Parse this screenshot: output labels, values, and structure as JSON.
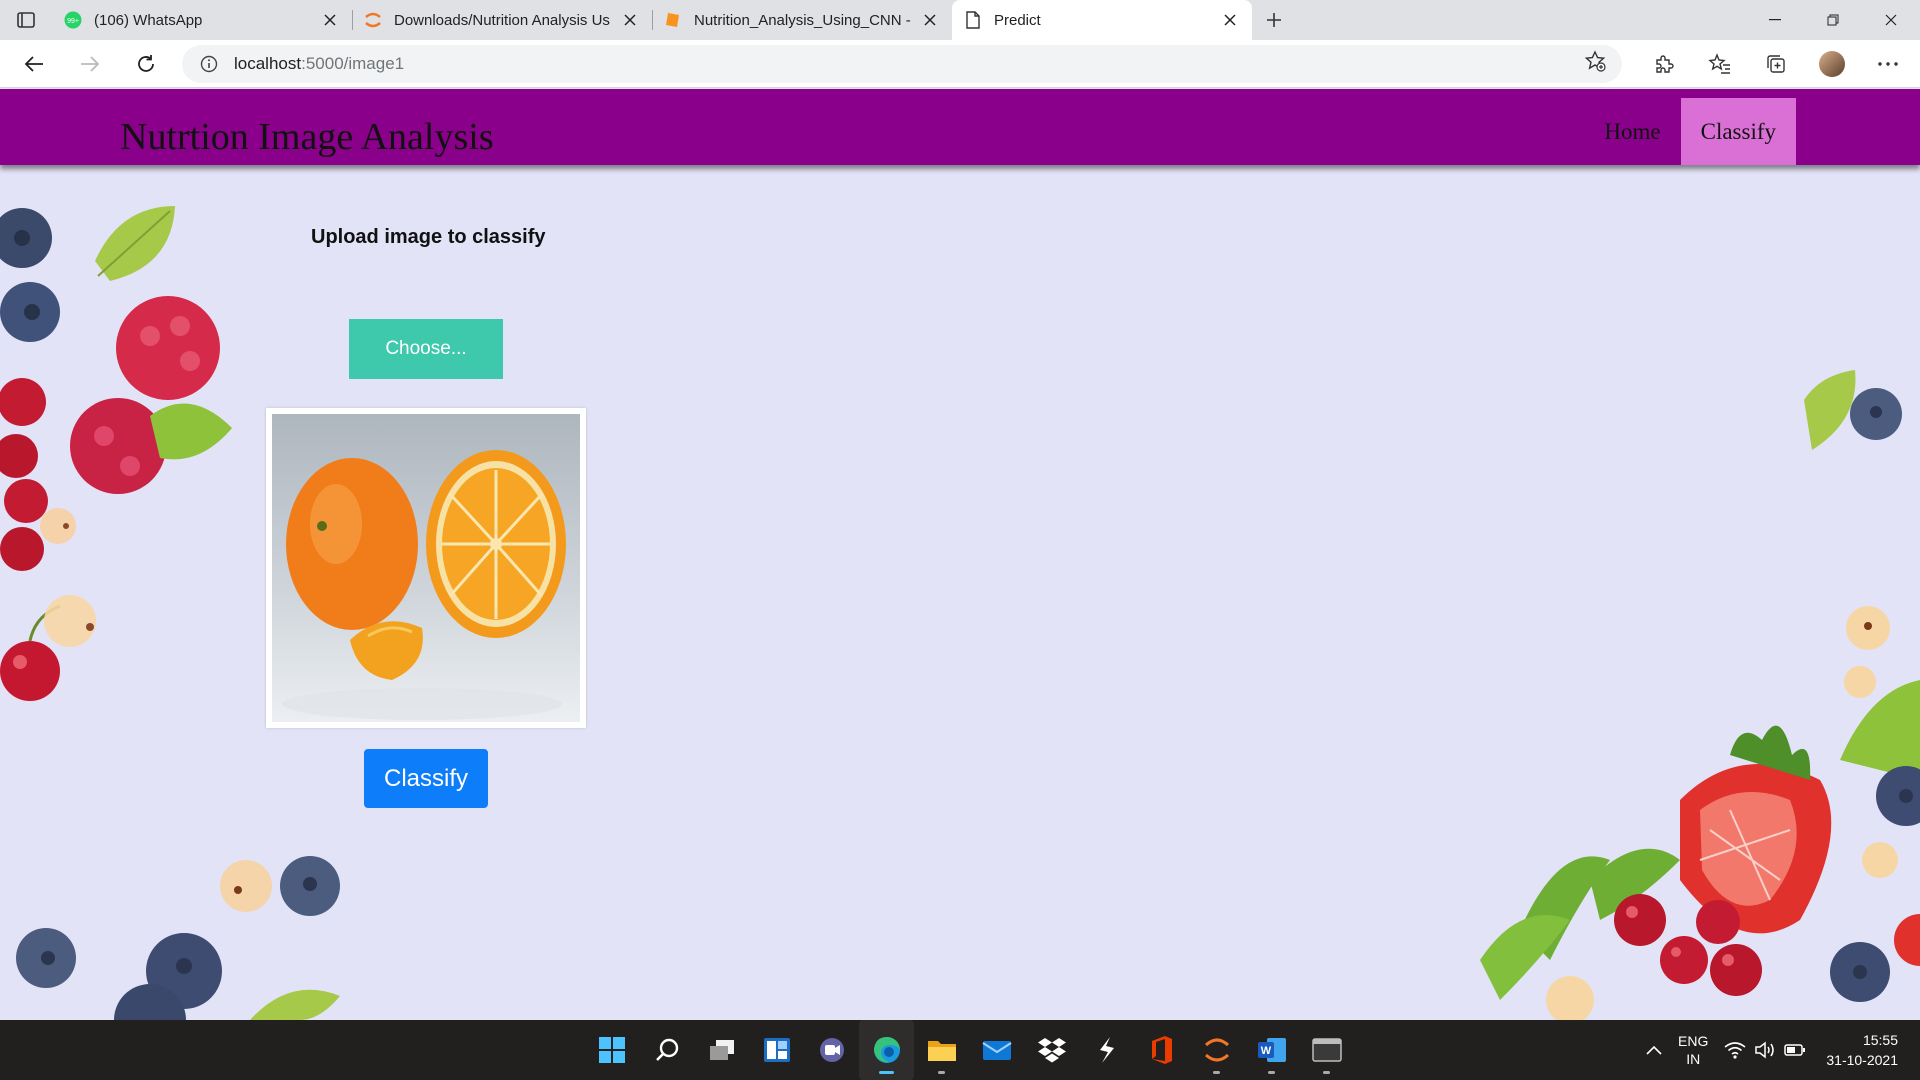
{
  "browser": {
    "tabs": [
      {
        "title": "(106) WhatsApp",
        "icon": "whatsapp-icon",
        "badge": "99+"
      },
      {
        "title": "Downloads/Nutrition Analysis Us",
        "icon": "jupyter-icon"
      },
      {
        "title": "Nutrition_Analysis_Using_CNN -",
        "icon": "notebook-icon"
      },
      {
        "title": "Predict",
        "icon": "page-icon",
        "active": true
      }
    ],
    "url_host": "localhost",
    "url_path": ":5000/image1"
  },
  "header": {
    "title": "Nutrtion Image Analysis",
    "nav": [
      {
        "label": "Home",
        "active": false
      },
      {
        "label": "Classify",
        "active": true
      }
    ],
    "bg_color": "#8b008b",
    "active_color": "#da70d6"
  },
  "main": {
    "heading": "Upload image to classify",
    "choose_label": "Choose...",
    "classify_label": "Classify",
    "preview_subject": "orange fruit"
  },
  "taskbar": {
    "apps": [
      "windows-start-icon",
      "search-icon",
      "task-view-icon",
      "widgets-icon",
      "teams-chat-icon",
      "edge-icon",
      "file-explorer-icon",
      "mail-icon",
      "dropbox-icon",
      "vscode-icon",
      "office-icon",
      "jupyter-icon",
      "word-icon",
      "terminal-icon"
    ],
    "lang_line1": "ENG",
    "lang_line2": "IN",
    "time": "15:55",
    "date": "31-10-2021"
  }
}
